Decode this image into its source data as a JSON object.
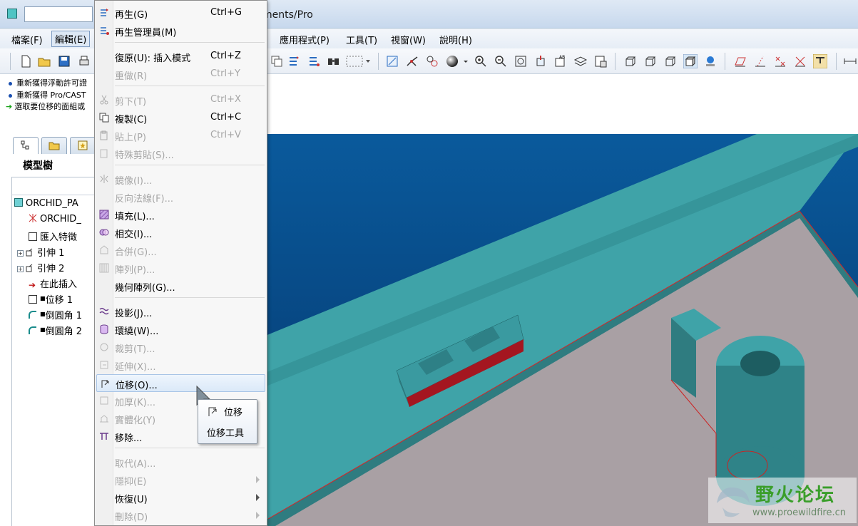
{
  "window": {
    "title": "ments/Pro"
  },
  "menubar": {
    "items": [
      {
        "label": "檔案(F)"
      },
      {
        "label": "編輯(E)"
      },
      {
        "label": "應用程式(P)"
      },
      {
        "label": "工具(T)"
      },
      {
        "label": "視窗(W)"
      },
      {
        "label": "說明(H)"
      }
    ]
  },
  "messages": [
    {
      "text": "重新獲得浮動許可證"
    },
    {
      "text": "重新獲得 Pro/CAST"
    },
    {
      "text": "選取要位移的面組或"
    }
  ],
  "left_panel": {
    "title": "模型樹",
    "tree": [
      {
        "label": "ORCHID_PA"
      },
      {
        "label": "ORCHID_"
      },
      {
        "label": "匯入特徵"
      },
      {
        "label": "引伸 1"
      },
      {
        "label": "引伸 2"
      },
      {
        "label": "在此插入"
      },
      {
        "label": "位移 1"
      },
      {
        "label": "倒圓角 1"
      },
      {
        "label": "倒圓角 2"
      }
    ]
  },
  "edit_menu": {
    "items": [
      {
        "label": "再生(G)",
        "shortcut": "Ctrl+G"
      },
      {
        "label": "再生管理員(M)",
        "shortcut": ""
      },
      {
        "label": "復原(U): 插入模式",
        "shortcut": "Ctrl+Z"
      },
      {
        "label": "重做(R)",
        "shortcut": "Ctrl+Y"
      },
      {
        "label": "剪下(T)",
        "shortcut": "Ctrl+X"
      },
      {
        "label": "複製(C)",
        "shortcut": "Ctrl+C"
      },
      {
        "label": "貼上(P)",
        "shortcut": "Ctrl+V"
      },
      {
        "label": "特殊剪貼(S)...",
        "shortcut": ""
      },
      {
        "label": "鏡像(I)...",
        "shortcut": ""
      },
      {
        "label": "反向法線(F)...",
        "shortcut": ""
      },
      {
        "label": "填充(L)...",
        "shortcut": ""
      },
      {
        "label": "相交(I)...",
        "shortcut": ""
      },
      {
        "label": "合併(G)...",
        "shortcut": ""
      },
      {
        "label": "陣列(P)...",
        "shortcut": ""
      },
      {
        "label": "幾何陣列(G)...",
        "shortcut": ""
      },
      {
        "label": "投影(J)...",
        "shortcut": ""
      },
      {
        "label": "環繞(W)...",
        "shortcut": ""
      },
      {
        "label": "裁剪(T)...",
        "shortcut": ""
      },
      {
        "label": "延伸(X)...",
        "shortcut": ""
      },
      {
        "label": "位移(O)...",
        "shortcut": ""
      },
      {
        "label": "加厚(K)...",
        "shortcut": ""
      },
      {
        "label": "實體化(Y)",
        "shortcut": ""
      },
      {
        "label": "移除...",
        "shortcut": ""
      },
      {
        "label": "取代(A)...",
        "shortcut": ""
      },
      {
        "label": "隱抑(E)",
        "shortcut": ""
      },
      {
        "label": "恢復(U)",
        "shortcut": ""
      },
      {
        "label": "刪除(D)",
        "shortcut": ""
      }
    ]
  },
  "tooltip": {
    "line1": "位移",
    "line2": "位移工具"
  },
  "watermark": {
    "title": "野火论坛",
    "url": "www.proewildfire.cn"
  },
  "colors": {
    "viewport_blue": "#0a5a9c",
    "model_teal": "#3fa3a8",
    "floor": "#a9a0a4",
    "highlight_red": "#a41620"
  }
}
